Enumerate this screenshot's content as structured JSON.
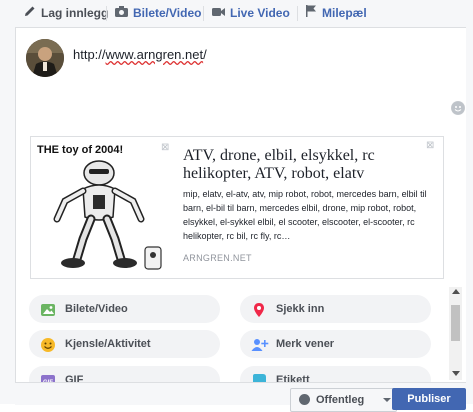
{
  "tabs": {
    "create_post": "Lag innlegg",
    "photo_video": "Bilete/Video",
    "live_video": "Live Video",
    "milestone": "Milepæl"
  },
  "composer": {
    "text_prefix": "http://",
    "text_link": "www.arngren.net",
    "text_suffix": "/"
  },
  "link_preview": {
    "image_caption": "THE toy of 2004!",
    "title": "ATV, drone, elbil, elsykkel, rc helikopter, ATV, robot, elatv",
    "description": "mip, elatv, el-atv, atv, mip robot, robot, mercedes barn, elbil til barn, el-bil til barn, mercedes elbil, drone, mip robot, robot, elsykkel, el-sykkel elbil, el scooter, elscooter, el-scooter, rc helikopter, rc bil, rc fly, rc…",
    "domain": "ARNGREN.NET",
    "close_symbol": "⊠"
  },
  "options": [
    {
      "label": "Bilete/Video",
      "icon": "photo-icon",
      "color": "#6bb563"
    },
    {
      "label": "Sjekk inn",
      "icon": "location-pin-icon",
      "color": "#f02849"
    },
    {
      "label": "Kjensle/Aktivitet",
      "icon": "smiley-icon",
      "color": "#f7b928"
    },
    {
      "label": "Merk vener",
      "icon": "tag-friends-icon",
      "color": "#5890ff"
    },
    {
      "label": "GIF",
      "icon": "gif-icon",
      "color": "#8c72cb"
    },
    {
      "label": "Etikett",
      "icon": "sticker-icon",
      "color": "#3cb4d8"
    }
  ],
  "footer": {
    "privacy": "Offentleg",
    "publish": "Publiser"
  },
  "colors": {
    "brand_blue": "#4267b2",
    "tab_bar_bg": "#f6f7f9",
    "option_bg": "#f2f3f5"
  }
}
